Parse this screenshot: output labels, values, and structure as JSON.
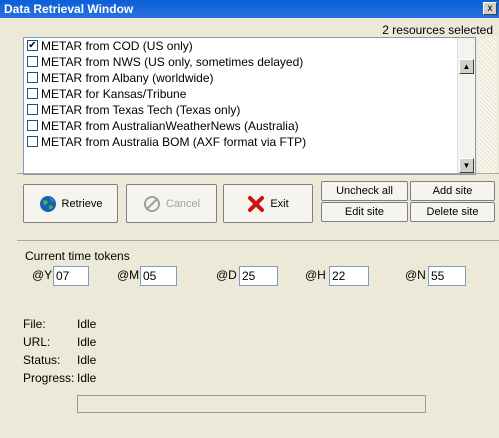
{
  "window": {
    "title": "Data Retrieval Window",
    "close_label": "x"
  },
  "resources_selected": "2 resources selected",
  "list": {
    "items": [
      {
        "label": "METAR from COD (US only)",
        "checked": true
      },
      {
        "label": "METAR from NWS (US only, sometimes delayed)",
        "checked": false
      },
      {
        "label": "METAR from Albany (worldwide)",
        "checked": false
      },
      {
        "label": "METAR for Kansas/Tribune",
        "checked": false
      },
      {
        "label": "METAR from Texas Tech (Texas only)",
        "checked": false
      },
      {
        "label": "METAR from AustralianWeatherNews (Australia)",
        "checked": false
      },
      {
        "label": "METAR from Australia BOM (AXF format via FTP)",
        "checked": false
      }
    ]
  },
  "buttons": {
    "retrieve": "Retrieve",
    "cancel": "Cancel",
    "exit": "Exit",
    "uncheck_all": "Uncheck all",
    "add_site": "Add site",
    "edit_site": "Edit site",
    "delete_site": "Delete site"
  },
  "time_tokens": {
    "title": "Current time tokens",
    "tokens": [
      {
        "label": "@Y",
        "value": "07"
      },
      {
        "label": "@M",
        "value": "05"
      },
      {
        "label": "@D",
        "value": "25"
      },
      {
        "label": "@H",
        "value": "22"
      },
      {
        "label": "@N",
        "value": "55"
      }
    ]
  },
  "info": {
    "file_label": "File:",
    "file_value": "Idle",
    "url_label": "URL:",
    "url_value": "Idle",
    "status_label": "Status:",
    "status_value": "Idle",
    "progress_label": "Progress:",
    "progress_value": "Idle",
    "progress_fraction": 0
  },
  "colors": {
    "titlebar": "#0a5fd8",
    "retrieve_icon": "#1a5fb4",
    "exit_icon": "#cc1111"
  }
}
